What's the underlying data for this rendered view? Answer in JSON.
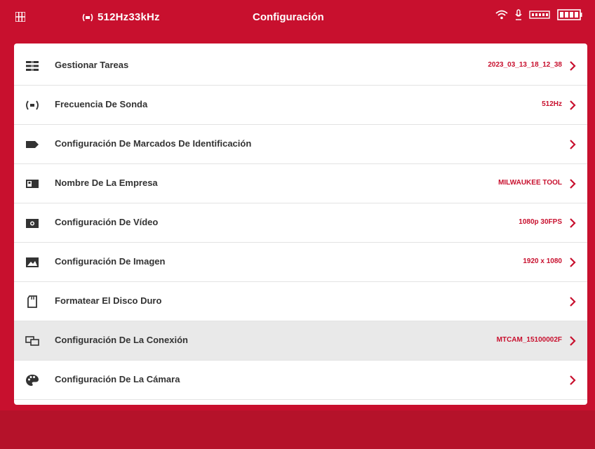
{
  "statusbar": {
    "frequency": "512Hz33kHz",
    "title": "Configuración"
  },
  "colors": {
    "accent": "#c8102e",
    "text": "#333333",
    "background": "#ffffff",
    "highlight": "#e9e9e9"
  },
  "menu": {
    "items": [
      {
        "icon": "tasks-icon",
        "label": "Gestionar Tareas",
        "value": "2023_03_13_18_12_38"
      },
      {
        "icon": "probe-frequency-icon",
        "label": "Frecuencia De Sonda",
        "value": "512Hz"
      },
      {
        "icon": "tag-icon",
        "label": "Configuración De Marcados De Identificación",
        "value": ""
      },
      {
        "icon": "company-card-icon",
        "label": "Nombre De La Empresa",
        "value": "MILWAUKEE TOOL"
      },
      {
        "icon": "video-camera-icon",
        "label": "Configuración De Vídeo",
        "value": "1080p 30FPS"
      },
      {
        "icon": "image-icon",
        "label": "Configuración De Imagen",
        "value": "1920 x 1080"
      },
      {
        "icon": "sd-card-icon",
        "label": "Formatear El Disco Duro",
        "value": ""
      },
      {
        "icon": "connection-icon",
        "label": "Configuración De La Conexión",
        "value": "MTCAM_15100002F"
      },
      {
        "icon": "palette-icon",
        "label": "Configuración De La Cámara",
        "value": ""
      }
    ]
  }
}
